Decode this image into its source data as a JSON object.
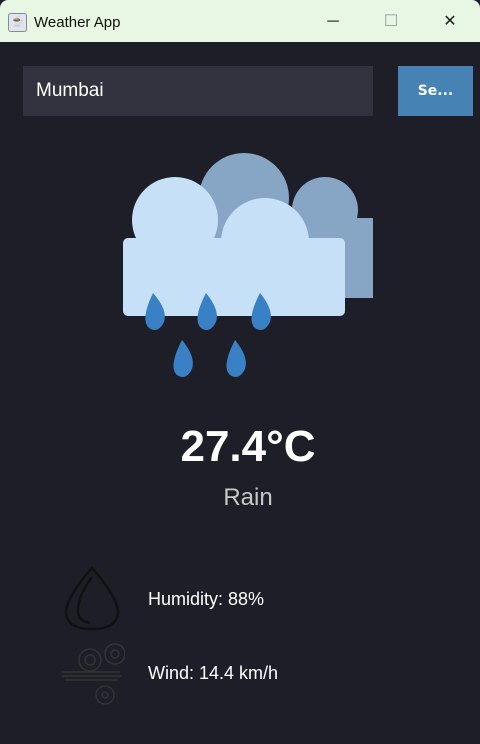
{
  "window": {
    "title": "Weather App",
    "app_icon": "java-icon",
    "controls": [
      "minimize-icon",
      "maximize-icon",
      "close-icon"
    ]
  },
  "search": {
    "value": "Mumbai",
    "button_label": "Se..."
  },
  "weather": {
    "icon": "rain-cloud-icon",
    "temperature": "27.4°C",
    "condition": "Rain"
  },
  "details": {
    "humidity": "Humidity: 88%",
    "wind": "Wind: 14.4 km/h",
    "humidity_icon": "humidity-drop-icon",
    "wind_icon": "wind-icon"
  },
  "colors": {
    "background": "#1e1e28",
    "button": "#4682b4",
    "cloud_front": "#c6e0f7",
    "cloud_back": "#87a5c4",
    "raindrop": "#3a80c4"
  }
}
